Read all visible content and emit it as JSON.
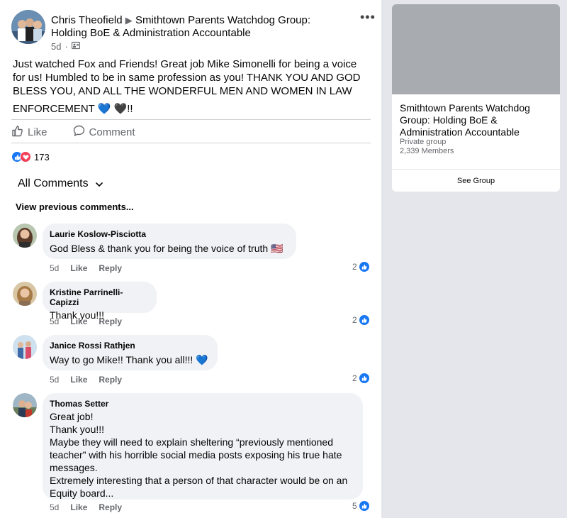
{
  "post": {
    "author": "Chris Theofield",
    "arrow": "▶",
    "group_name": "Smithtown Parents Watchdog Group: Holding BoE & Administration Accountable",
    "time": "5d",
    "separator": "·",
    "text_lines": [
      "Just watched Fox and Friends!  Great job Mike Simonelli for being a voice",
      "for us!  Humbled to be in same profession as you!  THANK YOU AND GOD",
      "BLESS YOU, AND ALL THE WONDERFUL MEN AND WOMEN IN LAW",
      "ENFORCEMENT 💙 🖤!!"
    ],
    "more_label": "•••",
    "like_label": "Like",
    "comment_label": "Comment",
    "reaction_count": "173"
  },
  "comments_section": {
    "filter_label": "All Comments",
    "view_previous": "View previous comments..."
  },
  "comments": [
    {
      "name": "Laurie Koslow-Pisciotta",
      "text": "God Bless & thank you for being the voice of truth 🇺🇸",
      "time": "5d",
      "like": "Like",
      "reply": "Reply",
      "reactions": "2"
    },
    {
      "name": "Kristine Parrinelli-Capizzi",
      "text": "Thank you!!!",
      "time": "5d",
      "like": "Like",
      "reply": "Reply",
      "reactions": "2"
    },
    {
      "name": "Janice Rossi Rathjen",
      "text": "Way to go Mike!! Thank you all!!! 💙",
      "time": "5d",
      "like": "Like",
      "reply": "Reply",
      "reactions": "2"
    },
    {
      "name": "Thomas Setter",
      "text_lines": [
        "Great job!",
        "Thank you!!!",
        "Maybe they will need to explain sheltering “previously mentioned",
        "teacher” with his horrible social media posts exposing his true hate",
        "messages.",
        "Extremely interesting that a person of that character would be on an",
        "Equity board..."
      ],
      "time": "5d",
      "like": "Like",
      "reply": "Reply",
      "reactions": "5"
    }
  ],
  "sidebar": {
    "group_title": "Smithtown Parents Watchdog Group: Holding BoE & Administration Accountable",
    "privacy": "Private group",
    "members": "2,339 Members",
    "button": "See Group"
  },
  "colors": {
    "accent": "#1877f2",
    "love": "#f33e58",
    "background": "#e4e6eb",
    "secondary_text": "#65676b"
  }
}
